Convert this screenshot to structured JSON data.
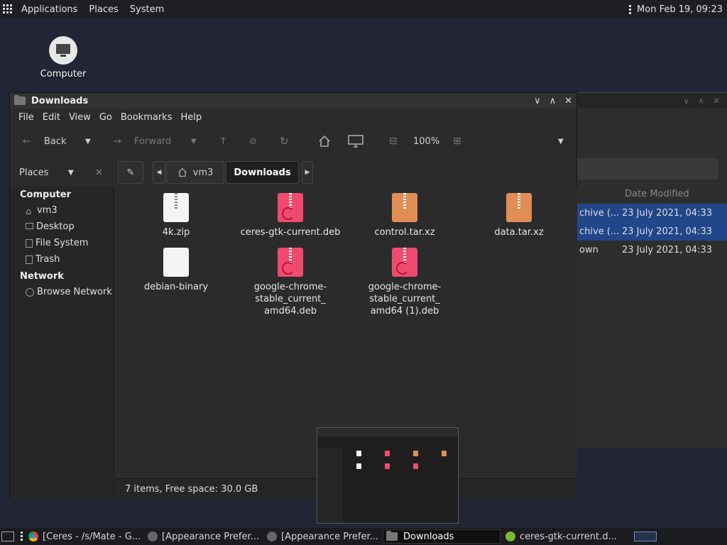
{
  "topbar": {
    "menus": [
      "Applications",
      "Places",
      "System"
    ],
    "clock": "Mon Feb 19, 09:23"
  },
  "desktop": {
    "icons": [
      {
        "label": "Computer",
        "icon": "computer-icon"
      }
    ]
  },
  "background_window": {
    "column_header": "Date Modified",
    "rows": [
      {
        "type": "chive (...",
        "date": "23 July 2021, 04:33",
        "selected": true
      },
      {
        "type": "chive (...",
        "date": "23 July 2021, 04:33",
        "selected": true
      },
      {
        "type": "own",
        "date": "23 July 2021, 04:33",
        "selected": false
      }
    ]
  },
  "window": {
    "title": "Downloads",
    "menu": [
      "File",
      "Edit",
      "View",
      "Go",
      "Bookmarks",
      "Help"
    ],
    "toolbar": {
      "back_label": "Back",
      "forward_label": "Forward",
      "zoom": "100%"
    },
    "pathbar": {
      "places_label": "Places",
      "crumbs": [
        "vm3",
        "Downloads"
      ]
    },
    "sidebar": {
      "sections": [
        {
          "heading": "Computer",
          "items": [
            "vm3",
            "Desktop",
            "File System",
            "Trash"
          ]
        },
        {
          "heading": "Network",
          "items": [
            "Browse Network"
          ]
        }
      ]
    },
    "files": [
      {
        "name": "4k.zip",
        "kind": "zip-white"
      },
      {
        "name": "ceres-gtk-current.deb",
        "kind": "deb-pink"
      },
      {
        "name": "control.tar.xz",
        "kind": "archive-tan"
      },
      {
        "name": "data.tar.xz",
        "kind": "archive-tan"
      },
      {
        "name": "debian-binary",
        "kind": "blank-white"
      },
      {
        "name": "google-chrome-stable_current_amd64.deb",
        "lines": [
          "google-chrome-",
          "stable_current_",
          "amd64.deb"
        ],
        "kind": "deb-pink"
      },
      {
        "name": "google-chrome-stable_current_amd64 (1).deb",
        "lines": [
          "google-chrome-",
          "stable_current_",
          "amd64 (1).deb"
        ],
        "kind": "deb-pink"
      }
    ],
    "status": "7 items, Free space: 30.0 GB"
  },
  "taskbar": {
    "tasks": [
      {
        "label": "[Ceres - /s/Mate - G...",
        "icon": "chrome-icon"
      },
      {
        "label": "[Appearance Prefer...",
        "icon": "appearance-icon"
      },
      {
        "label": "[Appearance Prefer...",
        "icon": "appearance-icon"
      },
      {
        "label": "Downloads",
        "icon": "folder-icon",
        "active": true
      },
      {
        "label": "ceres-gtk-current.d...",
        "icon": "package-icon"
      }
    ]
  },
  "colors": {
    "desktop_bg": "#212534",
    "selection": "#21468a",
    "deb_pink": "#ef4b6f",
    "archive_tan": "#e08e55"
  }
}
